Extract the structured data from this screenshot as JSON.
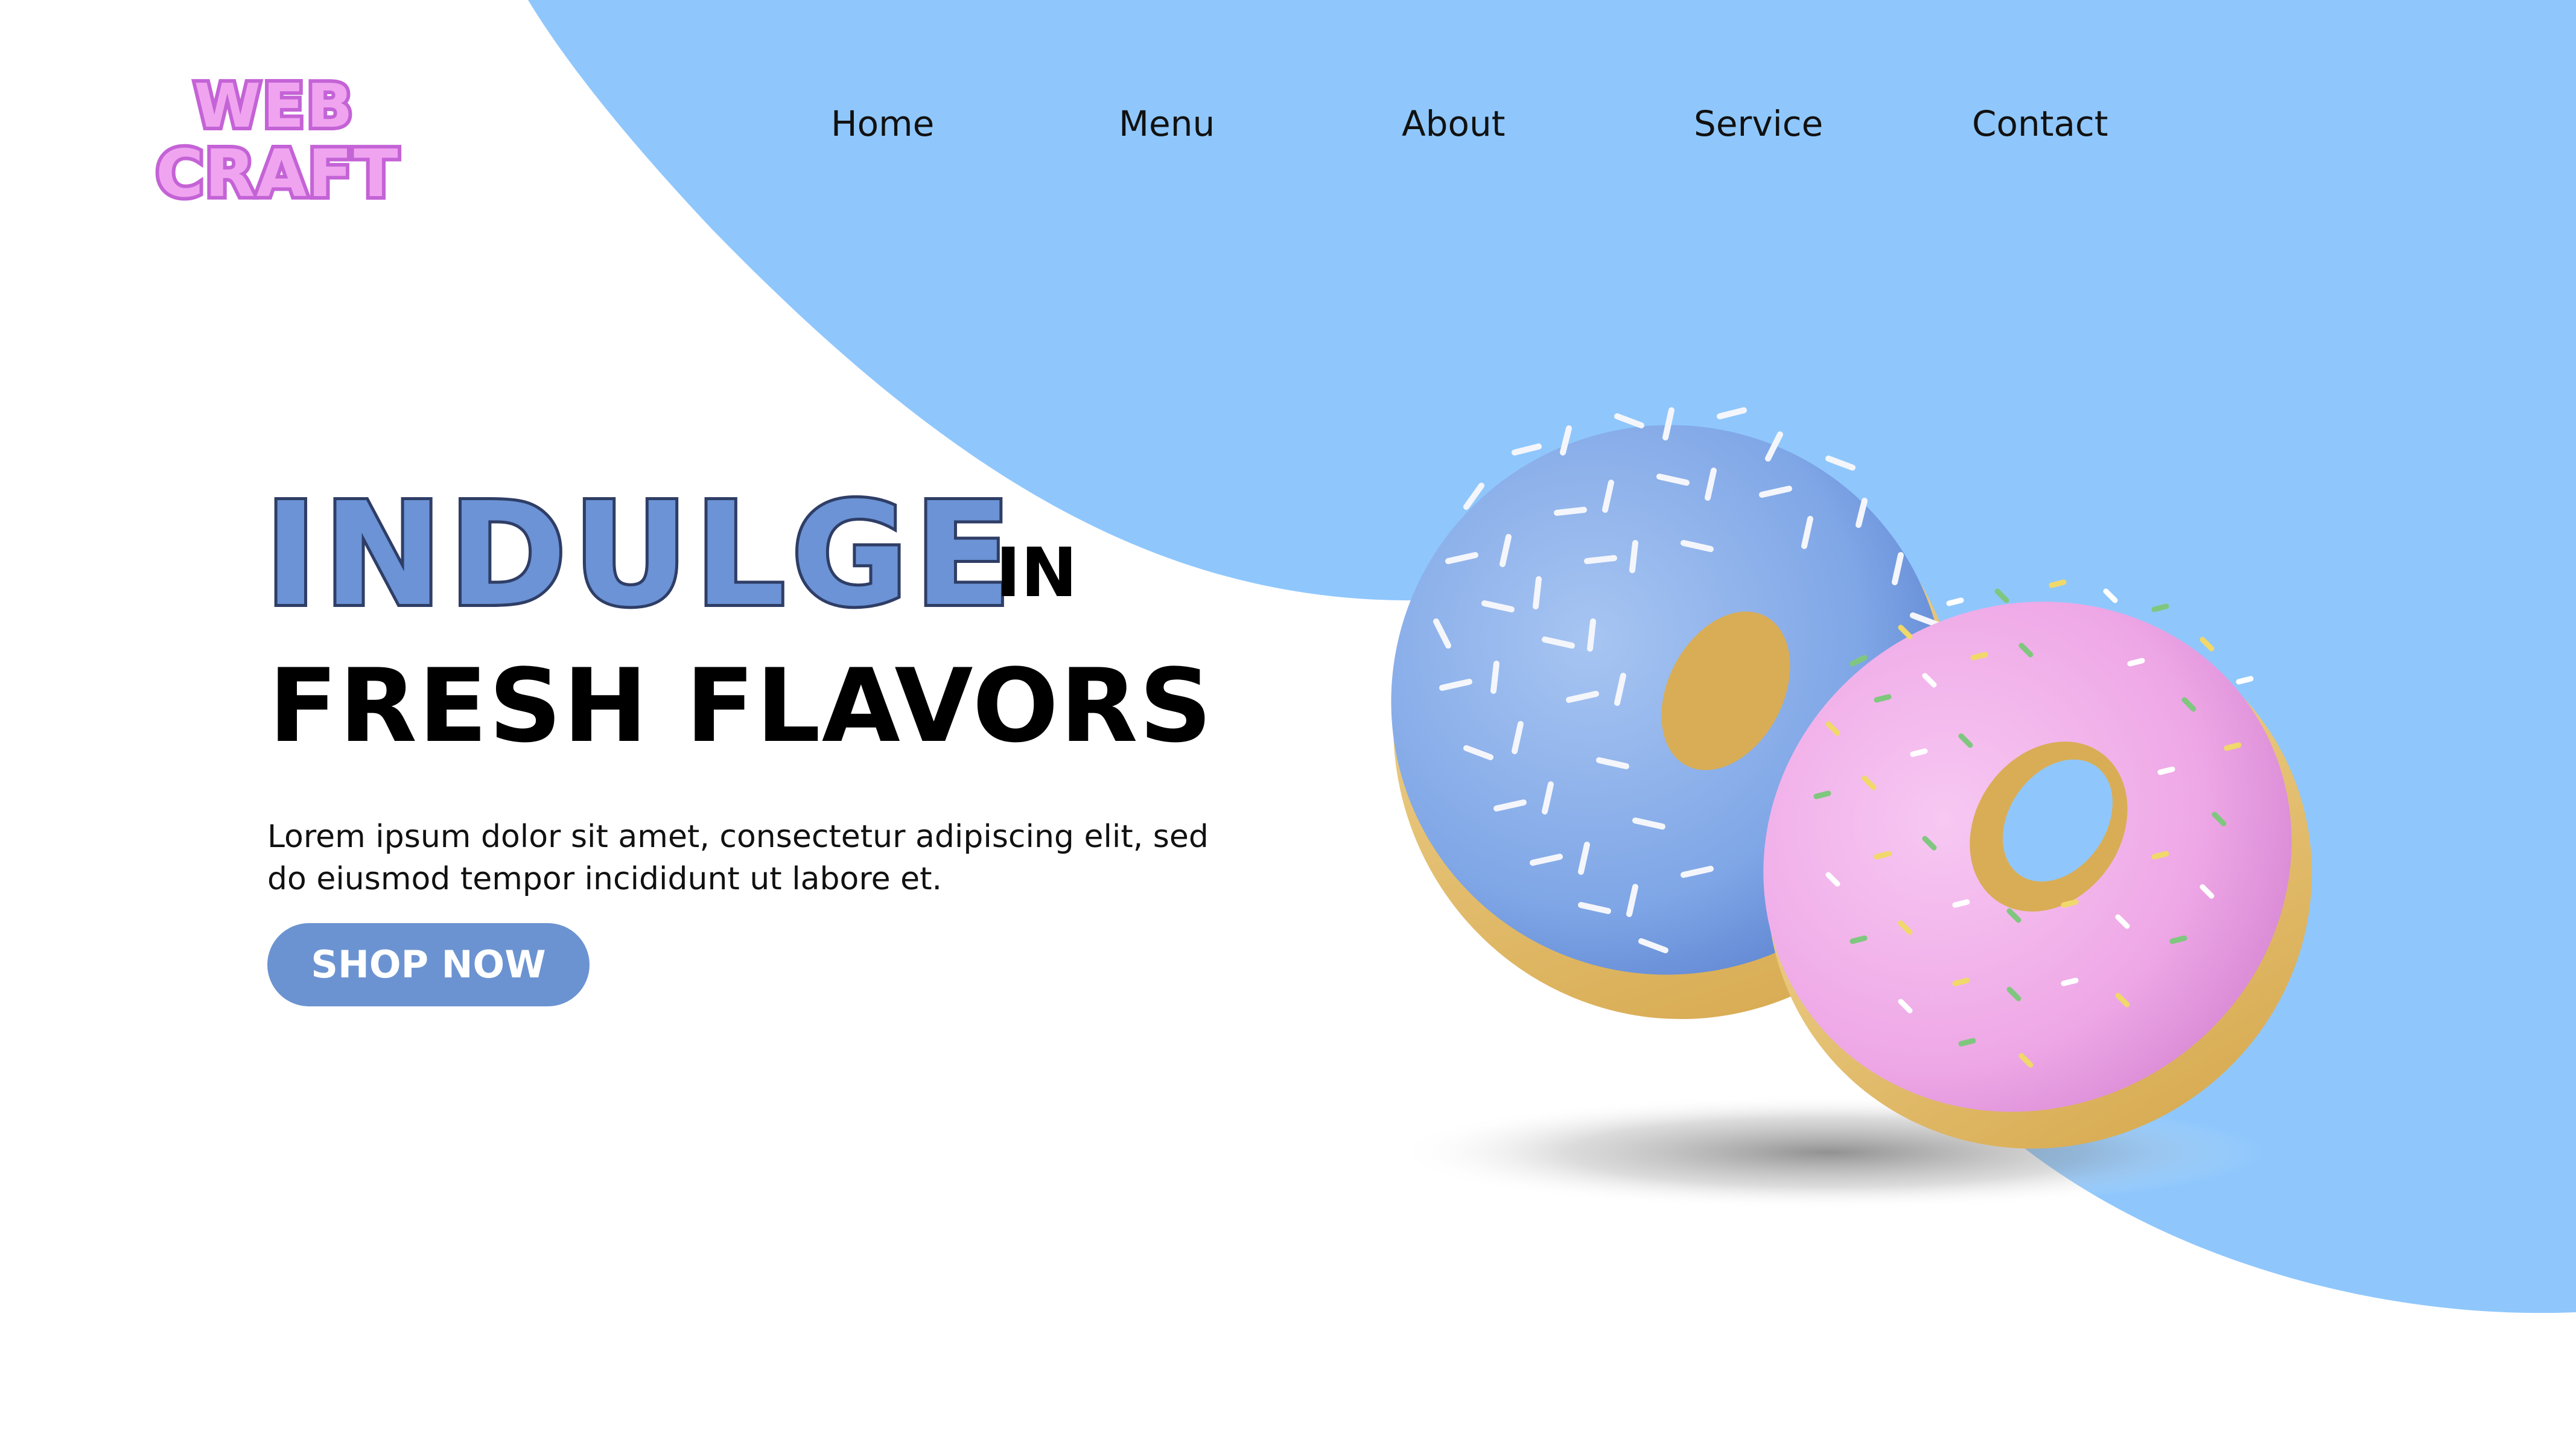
{
  "colors": {
    "background": "#ffffff",
    "accent_blue": "#8fc7fc",
    "button_blue": "#6c93d1",
    "headline_blue": "#6b93d6",
    "logo_pink": "#f0a4f0",
    "logo_outline": "#c463d6",
    "donut_blue_icing": "#8fb4ec",
    "donut_pink_icing": "#f2b6ec",
    "donut_dough": "#e9c87a"
  },
  "logo": {
    "line1": "WEB",
    "line2": "CRAFT"
  },
  "nav": {
    "items": [
      {
        "label": "Home"
      },
      {
        "label": "Menu"
      },
      {
        "label": "About"
      },
      {
        "label": "Service"
      },
      {
        "label": "Contact"
      }
    ]
  },
  "hero": {
    "headline_highlight": "INDULGE",
    "headline_connector": "IN",
    "headline_main": "FRESH FLAVORS",
    "body": "Lorem ipsum dolor sit amet, consectetur adipiscing elit, sed do eiusmod tempor incididunt ut labore et.",
    "cta_label": "SHOP NOW"
  },
  "illustration": {
    "icons": [
      "blue-sprinkled-donut-icon",
      "pink-sprinkled-donut-icon"
    ]
  }
}
